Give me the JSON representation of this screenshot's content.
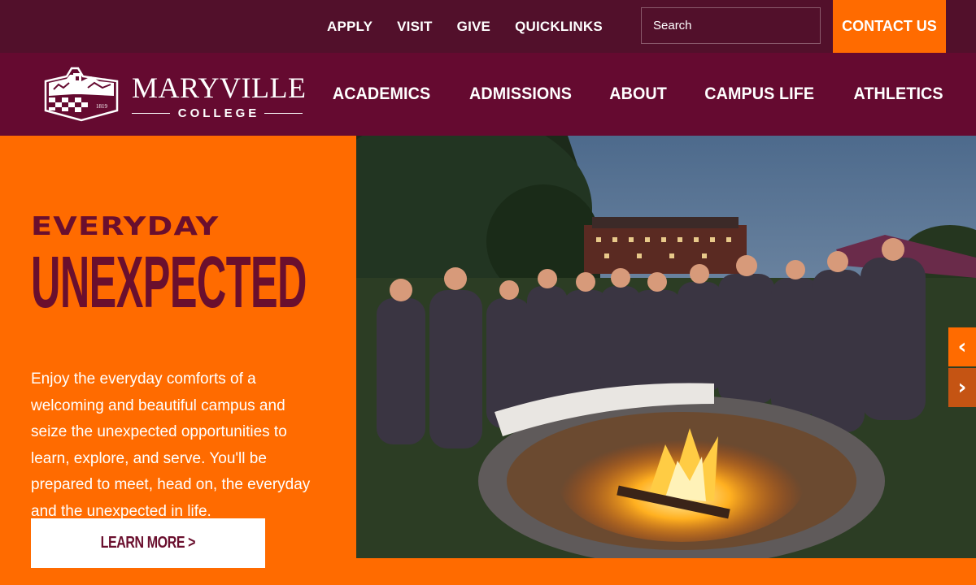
{
  "utility": {
    "links": [
      "APPLY",
      "VISIT",
      "GIVE",
      "QUICKLINKS"
    ],
    "search_placeholder": "Search",
    "contact_label": "CONTACT US"
  },
  "logo": {
    "name": "MARYVILLE",
    "subname": "COLLEGE",
    "year": "1819"
  },
  "nav": {
    "items": [
      "ACADEMICS",
      "ADMISSIONS",
      "ABOUT",
      "CAMPUS LIFE",
      "ATHLETICS"
    ]
  },
  "hero": {
    "kicker": "EVERYDAY",
    "title": "UNEXPECTED",
    "body": "Enjoy the everyday comforts of a welcoming and beautiful campus and seize the unexpected opportunities to learn, explore, and serve. You'll be prepared to meet, head on, the everyday and the unexpected in life.",
    "cta": "LEARN MORE >"
  },
  "carousel": {
    "prev_icon": "chevron-left-icon",
    "next_icon": "chevron-right-icon"
  },
  "colors": {
    "maroon_dark": "#52102b",
    "maroon": "#650a30",
    "orange": "#ff6b00",
    "title_maroon": "#6a0f2e"
  }
}
